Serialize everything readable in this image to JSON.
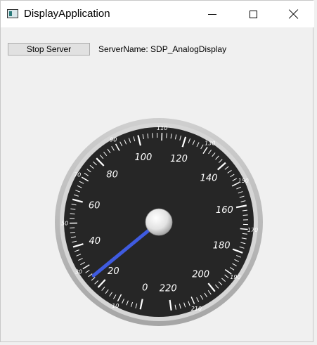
{
  "window": {
    "title": "DisplayApplication",
    "icon": "app-window-icon",
    "controls": [
      "minimize",
      "maximize",
      "close"
    ]
  },
  "toolbar": {
    "stop_button_label": "Stop Server",
    "server_label": "ServerName:",
    "server_name": "SDP_AnalogDisplay"
  },
  "gauge": {
    "min": 0,
    "max": 220,
    "value": 25,
    "major_labels": [
      "0",
      "20",
      "40",
      "60",
      "80",
      "100",
      "120",
      "140",
      "160",
      "180",
      "200",
      "220"
    ],
    "minor_labels": [
      "10",
      "30",
      "50",
      "70",
      "90",
      "110",
      "130",
      "150",
      "170",
      "190",
      "210"
    ],
    "colors": {
      "bezel": "#b9b9b9",
      "face": "#262626",
      "needle": "#3f5be0",
      "ticks": "#ffffff"
    }
  }
}
